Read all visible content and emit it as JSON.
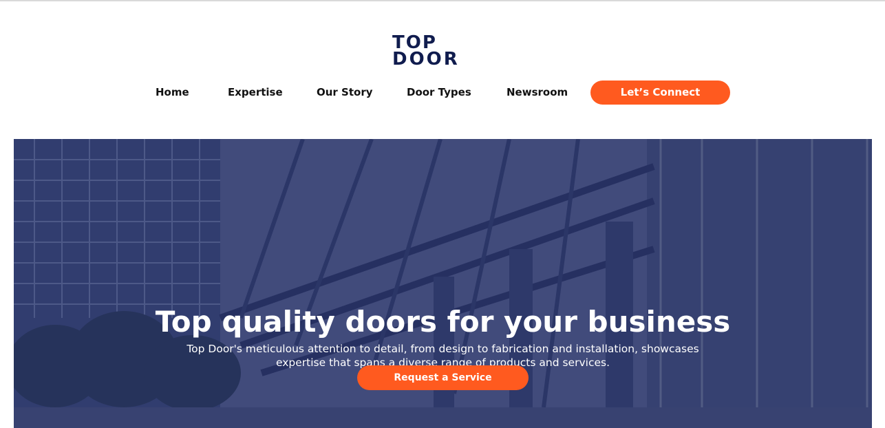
{
  "brand": {
    "logo_line1": "TOP",
    "logo_line2": "DOOR",
    "color": "#101c4e"
  },
  "nav": {
    "items": [
      {
        "label": "Home"
      },
      {
        "label": "Expertise"
      },
      {
        "label": "Our Story"
      },
      {
        "label": "Door Types"
      },
      {
        "label": "Newsroom"
      }
    ],
    "cta_label": "Let’s Connect",
    "accent": "#ff5a1f"
  },
  "hero": {
    "title": "Top quality doors for your business",
    "text": "Top Door's meticulous attention to detail, from design to fabrication and installation, showcases expertise that spans a diverse range of products and services.",
    "button_label": "Request a Service"
  }
}
